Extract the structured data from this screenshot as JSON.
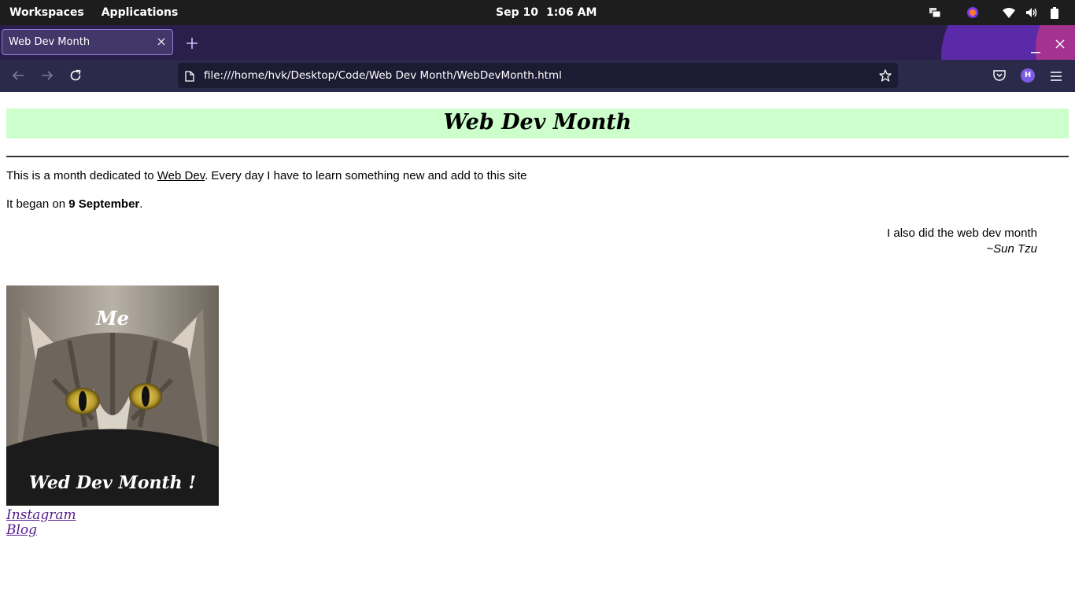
{
  "topbar": {
    "workspaces": "Workspaces",
    "applications": "Applications",
    "date": "Sep 10",
    "time": "1:06 AM"
  },
  "browser": {
    "tab_title": "Web Dev Month",
    "url": "file:///home/hvk/Desktop/Code/Web Dev Month/WebDevMonth.html",
    "account_initial": "H",
    "theme_colors": {
      "tabstrip": "#2a1f4a",
      "navbar": "#2b2a4a",
      "accent": "#8d7bd8"
    }
  },
  "page": {
    "title": "Web Dev Month",
    "intro_before": "This is a month dedicated to ",
    "intro_link": "Web Dev",
    "intro_after": ". Every day I have to learn something new and add to this site",
    "began_prefix": "It began on ",
    "began_date": "9 September",
    "began_suffix": ".",
    "quote_text": "I also did the web dev month",
    "quote_author": "~Sun Tzu",
    "image_caption_top": "Me",
    "image_caption_bottom": "Wed Dev Month !",
    "links": [
      "Instagram",
      "Blog"
    ],
    "banner_color": "#ccffcc",
    "link_color": "#551a8b"
  }
}
